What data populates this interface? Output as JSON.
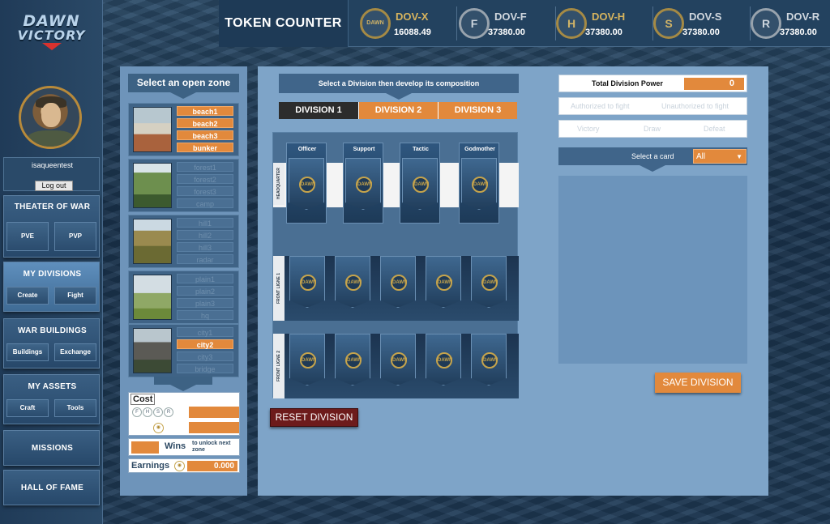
{
  "logo": {
    "line1": "DAWN",
    "line2": "VICTORY"
  },
  "user": {
    "name": "isaqueentest",
    "logout_label": "Log out"
  },
  "nav": {
    "theater": {
      "title": "THEATER OF WAR",
      "pve": "PVE",
      "pvp": "PVP"
    },
    "divisions": {
      "title": "MY DIVISIONS",
      "create": "Create",
      "fight": "Fight"
    },
    "buildings": {
      "title": "WAR BUILDINGS",
      "buildings": "Buildings",
      "exchange": "Exchange"
    },
    "assets": {
      "title": "MY ASSETS",
      "craft": "Craft",
      "tools": "Tools"
    },
    "missions": "MISSIONS",
    "hall": "HALL OF FAME"
  },
  "topbar": {
    "title": "TOKEN COUNTER",
    "tokens": [
      {
        "name": "DOV-X",
        "value": "16088.49",
        "glyph": "DAWN"
      },
      {
        "name": "DOV-F",
        "value": "37380.00",
        "glyph": "F"
      },
      {
        "name": "DOV-H",
        "value": "37380.00",
        "glyph": "H"
      },
      {
        "name": "DOV-S",
        "value": "37380.00",
        "glyph": "S"
      },
      {
        "name": "DOV-R",
        "value": "37380.00",
        "glyph": "R"
      }
    ]
  },
  "zones": {
    "header": "Select an open zone",
    "groups": [
      {
        "items": [
          "beach1",
          "beach2",
          "beach3",
          "bunker"
        ],
        "active": [
          true,
          true,
          true,
          true
        ]
      },
      {
        "items": [
          "forest1",
          "forest2",
          "forest3",
          "camp"
        ],
        "active": [
          false,
          false,
          false,
          false
        ]
      },
      {
        "items": [
          "hill1",
          "hill2",
          "hill3",
          "radar"
        ],
        "active": [
          false,
          false,
          false,
          false
        ]
      },
      {
        "items": [
          "plain1",
          "plain2",
          "plain3",
          "hq"
        ],
        "active": [
          false,
          false,
          false,
          false
        ]
      },
      {
        "items": [
          "city1",
          "city2",
          "city3",
          "bridge"
        ],
        "active": [
          false,
          true,
          false,
          false
        ]
      }
    ],
    "cost_label": "Cost",
    "cost_icons": [
      "F",
      "H",
      "S",
      "R"
    ],
    "wins_label": "Wins",
    "wins_note": "to unlock next zone",
    "earnings_label": "Earnings",
    "earnings_value": "0.000"
  },
  "division": {
    "header": "Select a Division then develop its composition",
    "tabs": [
      "DIVISION 1",
      "DIVISION 2",
      "DIVISION 3"
    ],
    "hq_label": "HEADQUARTER",
    "hq_cards": [
      "Officer",
      "Support",
      "Tactic",
      "Godmother"
    ],
    "front1_label": "FRONT LIGNE 1",
    "front2_label": "FRONT LIGNE 2",
    "emblem": "DAWN",
    "reset_label": "RESET DIVISION"
  },
  "right": {
    "power_label": "Total Division Power",
    "power_value": "0",
    "authorized": "Authorized to fight",
    "unauthorized": "Unauthorized to fight",
    "victory": "Victory",
    "draw": "Draw",
    "defeat": "Defeat",
    "card_select_label": "Select a card",
    "card_filter": "All",
    "save_label": "SAVE DIVISION"
  },
  "colors": {
    "accent": "#e2893c",
    "panel": "#7ea4c8",
    "dark": "#23425f",
    "reset": "#6d1b1b"
  }
}
